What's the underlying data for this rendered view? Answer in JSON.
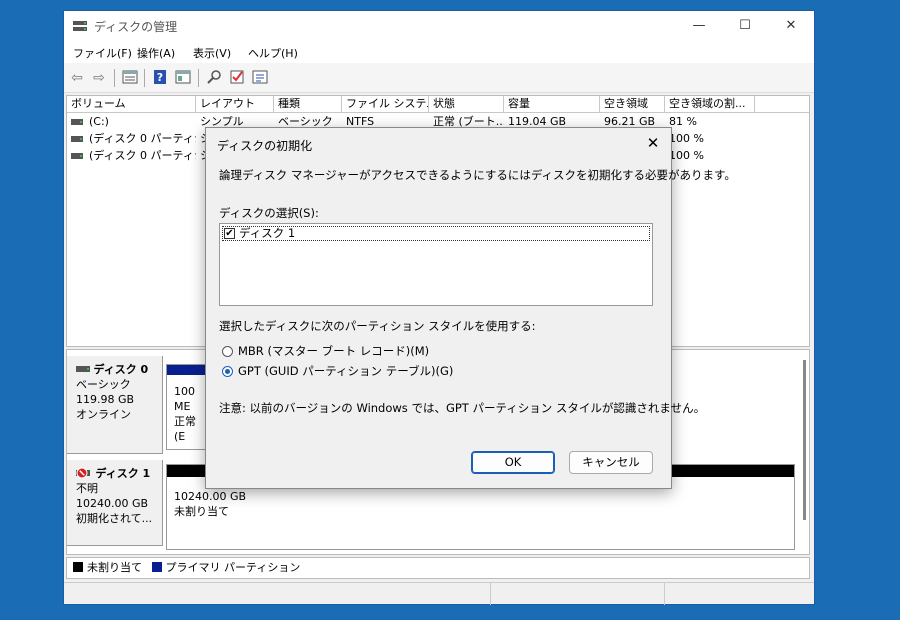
{
  "window": {
    "title": "ディスクの管理",
    "minimize": "—",
    "maximize": "☐",
    "close": "✕"
  },
  "menu": [
    "ファイル(F)",
    "操作(A)",
    "表示(V)",
    "ヘルプ(H)"
  ],
  "toolbar_icons": [
    "back-arrow-icon",
    "forward-arrow-icon",
    "list-view-icon",
    "help-icon",
    "properties-icon",
    "connect-icon",
    "check-icon",
    "options-icon"
  ],
  "volume_table": {
    "headers": [
      "ボリューム",
      "レイアウト",
      "種類",
      "ファイル システム",
      "状態",
      "容量",
      "空き領域",
      "空き領域の割..."
    ],
    "rows": [
      [
        "(C:)",
        "シンプル",
        "ベーシック",
        "NTFS",
        "正常 (ブート...",
        "119.04 GB",
        "96.21 GB",
        "81 %"
      ],
      [
        "(ディスク 0 パーティシ...",
        "シ",
        "",
        "",
        "",
        "",
        "",
        "100 %"
      ],
      [
        "(ディスク 0 パーティシ...",
        "シ",
        "",
        "",
        "",
        "",
        "",
        "100 %"
      ]
    ]
  },
  "disks": [
    {
      "name": "ディスク 0",
      "type": "ベーシック",
      "size": "119.98 GB",
      "status": "オンライン",
      "partition_line1": "100 ME",
      "partition_line2": "正常 (E"
    },
    {
      "name": "ディスク 1",
      "type": "不明",
      "size": "10240.00 GB",
      "status": "初期化されて...",
      "partition_line1": "10240.00 GB",
      "partition_line2": "未割り当て"
    }
  ],
  "legend": {
    "unallocated": "未割り当て",
    "primary": "プライマリ パーティション"
  },
  "colors": {
    "unallocated": "#000000",
    "primary": "#0a1f8f",
    "accent": "#1a5fb4",
    "desktop": "#1a6db5"
  },
  "dialog": {
    "title": "ディスクの初期化",
    "close": "✕",
    "message": "論理ディスク マネージャーがアクセスできるようにするにはディスクを初期化する必要があります。",
    "select_label": "ディスクの選択(S):",
    "disk_item": "ディスク 1",
    "disk_checked": true,
    "style_label": "選択したディスクに次のパーティション スタイルを使用する:",
    "mbr_label": "MBR (マスター ブート レコード)(M)",
    "gpt_label": "GPT (GUID パーティション テーブル)(G)",
    "selected_style": "GPT",
    "note": "注意: 以前のバージョンの Windows では、GPT パーティション スタイルが認識されません。",
    "ok": "OK",
    "cancel": "キャンセル"
  }
}
